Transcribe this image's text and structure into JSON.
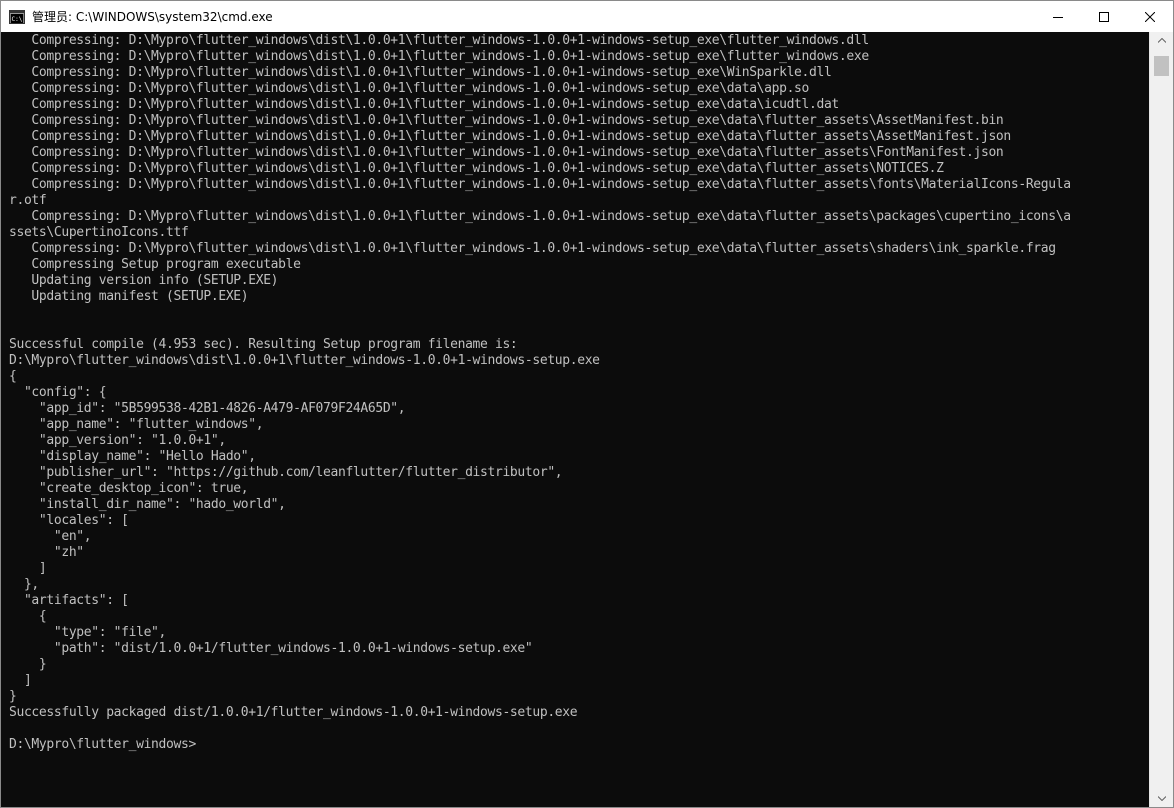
{
  "window": {
    "title": "管理员: C:\\WINDOWS\\system32\\cmd.exe",
    "icon": "cmd-app-icon",
    "controls": {
      "minimize": "minimize-icon",
      "maximize": "maximize-icon",
      "close": "close-icon"
    }
  },
  "console": {
    "lines": [
      "   Compressing: D:\\Mypro\\flutter_windows\\dist\\1.0.0+1\\flutter_windows-1.0.0+1-windows-setup_exe\\flutter_windows.dll",
      "   Compressing: D:\\Mypro\\flutter_windows\\dist\\1.0.0+1\\flutter_windows-1.0.0+1-windows-setup_exe\\flutter_windows.exe",
      "   Compressing: D:\\Mypro\\flutter_windows\\dist\\1.0.0+1\\flutter_windows-1.0.0+1-windows-setup_exe\\WinSparkle.dll",
      "   Compressing: D:\\Mypro\\flutter_windows\\dist\\1.0.0+1\\flutter_windows-1.0.0+1-windows-setup_exe\\data\\app.so",
      "   Compressing: D:\\Mypro\\flutter_windows\\dist\\1.0.0+1\\flutter_windows-1.0.0+1-windows-setup_exe\\data\\icudtl.dat",
      "   Compressing: D:\\Mypro\\flutter_windows\\dist\\1.0.0+1\\flutter_windows-1.0.0+1-windows-setup_exe\\data\\flutter_assets\\AssetManifest.bin",
      "   Compressing: D:\\Mypro\\flutter_windows\\dist\\1.0.0+1\\flutter_windows-1.0.0+1-windows-setup_exe\\data\\flutter_assets\\AssetManifest.json",
      "   Compressing: D:\\Mypro\\flutter_windows\\dist\\1.0.0+1\\flutter_windows-1.0.0+1-windows-setup_exe\\data\\flutter_assets\\FontManifest.json",
      "   Compressing: D:\\Mypro\\flutter_windows\\dist\\1.0.0+1\\flutter_windows-1.0.0+1-windows-setup_exe\\data\\flutter_assets\\NOTICES.Z",
      "   Compressing: D:\\Mypro\\flutter_windows\\dist\\1.0.0+1\\flutter_windows-1.0.0+1-windows-setup_exe\\data\\flutter_assets\\fonts\\MaterialIcons-Regula",
      "r.otf",
      "   Compressing: D:\\Mypro\\flutter_windows\\dist\\1.0.0+1\\flutter_windows-1.0.0+1-windows-setup_exe\\data\\flutter_assets\\packages\\cupertino_icons\\a",
      "ssets\\CupertinoIcons.ttf",
      "   Compressing: D:\\Mypro\\flutter_windows\\dist\\1.0.0+1\\flutter_windows-1.0.0+1-windows-setup_exe\\data\\flutter_assets\\shaders\\ink_sparkle.frag",
      "   Compressing Setup program executable",
      "   Updating version info (SETUP.EXE)",
      "   Updating manifest (SETUP.EXE)",
      "",
      "",
      "Successful compile (4.953 sec). Resulting Setup program filename is:",
      "D:\\Mypro\\flutter_windows\\dist\\1.0.0+1\\flutter_windows-1.0.0+1-windows-setup.exe",
      "{",
      "  \"config\": {",
      "    \"app_id\": \"5B599538-42B1-4826-A479-AF079F24A65D\",",
      "    \"app_name\": \"flutter_windows\",",
      "    \"app_version\": \"1.0.0+1\",",
      "    \"display_name\": \"Hello Hado\",",
      "    \"publisher_url\": \"https://github.com/leanflutter/flutter_distributor\",",
      "    \"create_desktop_icon\": true,",
      "    \"install_dir_name\": \"hado_world\",",
      "    \"locales\": [",
      "      \"en\",",
      "      \"zh\"",
      "    ]",
      "  },",
      "  \"artifacts\": [",
      "    {",
      "      \"type\": \"file\",",
      "      \"path\": \"dist/1.0.0+1/flutter_windows-1.0.0+1-windows-setup.exe\"",
      "    }",
      "  ]",
      "}",
      "Successfully packaged dist/1.0.0+1/flutter_windows-1.0.0+1-windows-setup.exe",
      "",
      "D:\\Mypro\\flutter_windows>"
    ],
    "green_line_index": 43,
    "prompt_line_index": 45,
    "colors": {
      "background": "#0c0c0c",
      "text": "#c0c0c0",
      "success": "#13c10e"
    }
  },
  "scrollbar": {
    "up": "scroll-up-arrow-icon",
    "down": "scroll-down-arrow-icon"
  }
}
